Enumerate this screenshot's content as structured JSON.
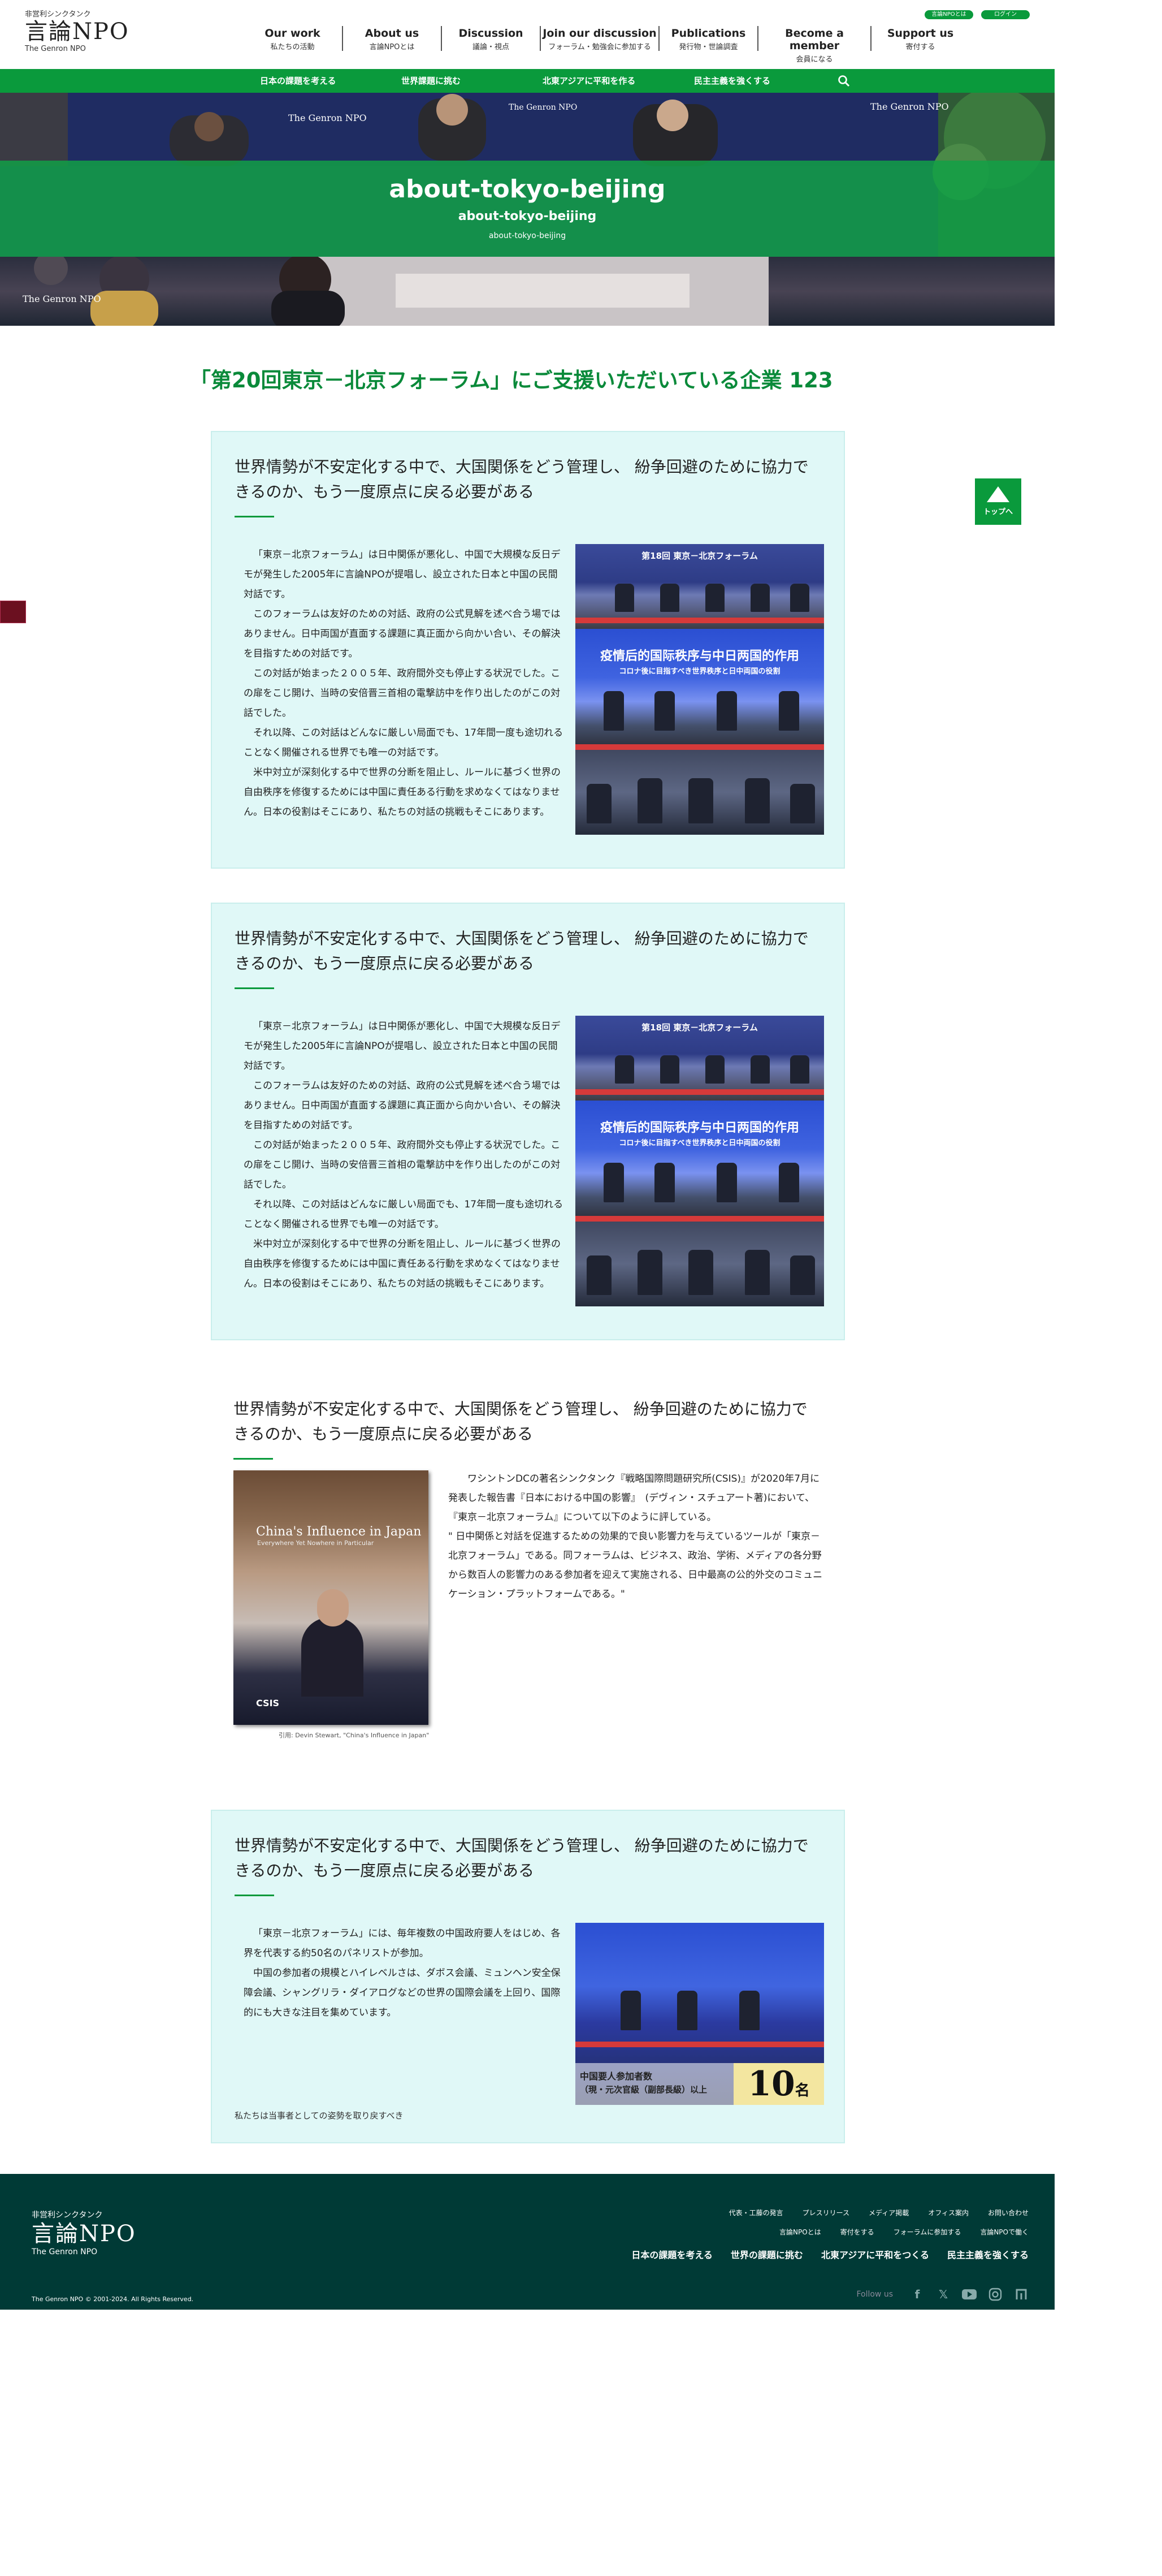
{
  "header": {
    "logo_small": "非営利シンクタンク",
    "logo_big": "言論NPO",
    "logo_en": "The Genron NPO",
    "top_buttons": [
      "言論NPOとは",
      "ログイン"
    ],
    "nav": [
      {
        "en": "Our work",
        "ja": "私たちの活動"
      },
      {
        "en": "About us",
        "ja": "言論NPOとは"
      },
      {
        "en": "Discussion",
        "ja": "議論・視点"
      },
      {
        "en": "Join our discussion",
        "ja": "フォーラム・勉強会に参加する"
      },
      {
        "en": "Publications",
        "ja": "発行物・世論調査"
      },
      {
        "en": "Become a member",
        "ja": "会員になる"
      },
      {
        "en": "Support us",
        "ja": "寄付する"
      }
    ],
    "greenbar": [
      "日本の課題を考える",
      "世界課題に挑む",
      "北東アジアに平和を作る",
      "民主主義を強くする"
    ]
  },
  "hero": {
    "title": "about-tokyo-beijing",
    "subtitle": "about-tokyo-beijing",
    "breadcrumb": "about-tokyo-beijing"
  },
  "main": {
    "title": "「第20回東京－北京フォーラム」にご支援いただいている企業 123"
  },
  "cards": [
    {
      "heading": "世界情勢が不安定化する中で、大国関係をどう管理し、 紛争回避のために協力できるのか、もう一度原点に戻る必要がある",
      "paragraphs": [
        "「東京－北京フォーラム」は日中関係が悪化し、中国で大規模な反日デモが発生した2005年に言論NPOが提唱し、設立された日本と中国の民間対話です。",
        "このフォーラムは友好のための対話、政府の公式見解を述べ合う場ではありません。日中両国が直面する課題に真正面から向かい合い、その解決を目指すための対話です。",
        "この対話が始まった２００５年、政府間外交も停止する状況でした。この扉をこじ開け、当時の安倍晋三首相の電撃訪中を作り出したのがこの対話でした。",
        "それ以降、この対話はどんなに厳しい局面でも、17年間一度も途切れることなく開催される世界でも唯一の対話です。",
        "米中対立が深刻化する中で世界の分断を阻止し、ルールに基づく世界の自由秩序を修復するためには中国に責任ある行動を求めなくてはなりません。日本の役割はそこにあり、私たちの対話の挑戦もそこにあります。"
      ],
      "photo_captions": [
        "第18回 東京－北京フォーラム",
        "疫情后的国际秩序与中日两国的作用",
        "コロナ後に目指すべき世界秩序と日中両国の役割"
      ]
    },
    {
      "heading": "世界情勢が不安定化する中で、大国関係をどう管理し、 紛争回避のために協力できるのか、もう一度原点に戻る必要がある",
      "paragraphs": [
        "「東京－北京フォーラム」は日中関係が悪化し、中国で大規模な反日デモが発生した2005年に言論NPOが提唱し、設立された日本と中国の民間対話です。",
        "このフォーラムは友好のための対話、政府の公式見解を述べ合う場ではありません。日中両国が直面する課題に真正面から向かい合い、その解決を目指すための対話です。",
        "この対話が始まった２００５年、政府間外交も停止する状況でした。この扉をこじ開け、当時の安倍晋三首相の電撃訪中を作り出したのがこの対話でした。",
        "それ以降、この対話はどんなに厳しい局面でも、17年間一度も途切れることなく開催される世界でも唯一の対話です。",
        "米中対立が深刻化する中で世界の分断を阻止し、ルールに基づく世界の自由秩序を修復するためには中国に責任ある行動を求めなくてはなりません。日本の役割はそこにあり、私たちの対話の挑戦もそこにあります。"
      ],
      "photo_captions": [
        "第18回 東京－北京フォーラム",
        "疫情后的国际秩序与中日两国的作用",
        "コロナ後に目指すべき世界秩序と日中両国の役割"
      ]
    },
    {
      "heading": "世界情勢が不安定化する中で、大国関係をどう管理し、 紛争回避のために協力できるのか、もう一度原点に戻る必要がある",
      "book_title": "China's Influence in Japan",
      "book_sub": "Everywhere Yet Nowhere in Particular",
      "book_publisher": "CSIS",
      "book_caption": "引用: Devin Stewart, \"China's Influence in Japan\"",
      "paragraphs": [
        "ワシントンDCの著名シンクタンク『戦略国際問題研究所(CSIS)』が2020年7月に発表した報告書『日本における中国の影響』　(デヴィン・スチュアート著)において、『東京－北京フォーラム』について以下のように評している。",
        "\" 日中関係と対話を促進するための効果的で良い影響力を与えているツールが「東京－北京フォーラム」である。同フォーラムは、ビジネス、政治、学術、メディアの各分野から数百人の影響力のある参加者を迎えて実施される、日中最高の公的外交のコミュニケーション・プラットフォームである。\""
      ]
    },
    {
      "heading": "世界情勢が不安定化する中で、大国関係をどう管理し、 紛争回避のために協力できるのか、もう一度原点に戻る必要がある",
      "paragraphs": [
        "「東京－北京フォーラム」には、毎年複数の中国政府要人をはじめ、各界を代表する約50名のパネリストが参加。",
        "中国の参加者の規模とハイレベルさは、ダボス会議、ミュンヘン安全保障会議、シャングリラ・ダイアログなどの世界の国際会議を上回り、国際的にも大きな注目を集めています。"
      ],
      "stat_label": "中国要人参加者数",
      "stat_label2": "（現・元次官級（副部長級）以上",
      "stat_number": "10",
      "stat_unit": "名",
      "footer_note": "私たちは当事者としての姿勢を取り戻すべき"
    }
  ],
  "totop": "トップへ",
  "footer": {
    "logo_small": "非営利シンクタンク",
    "logo_big": "言論NPO",
    "logo_en": "The Genron NPO",
    "row1": [
      "代表・工藤の発言",
      "プレスリリース",
      "メディア掲載",
      "オフィス案内",
      "お問い合わせ"
    ],
    "row2": [
      "言論NPOとは",
      "寄付をする",
      "フォーラムに参加する",
      "言論NPOで働く"
    ],
    "row3": [
      "日本の課題を考える",
      "世界の課題に挑む",
      "北東アジアに平和をつくる",
      "民主主義を強くする"
    ],
    "copyright": "The Genron NPO © 2001-2024. All Rights Reserved.",
    "follow": "Follow us",
    "icons": [
      "facebook-icon",
      "x-icon",
      "youtube-icon",
      "instagram-icon",
      "note-icon"
    ]
  }
}
